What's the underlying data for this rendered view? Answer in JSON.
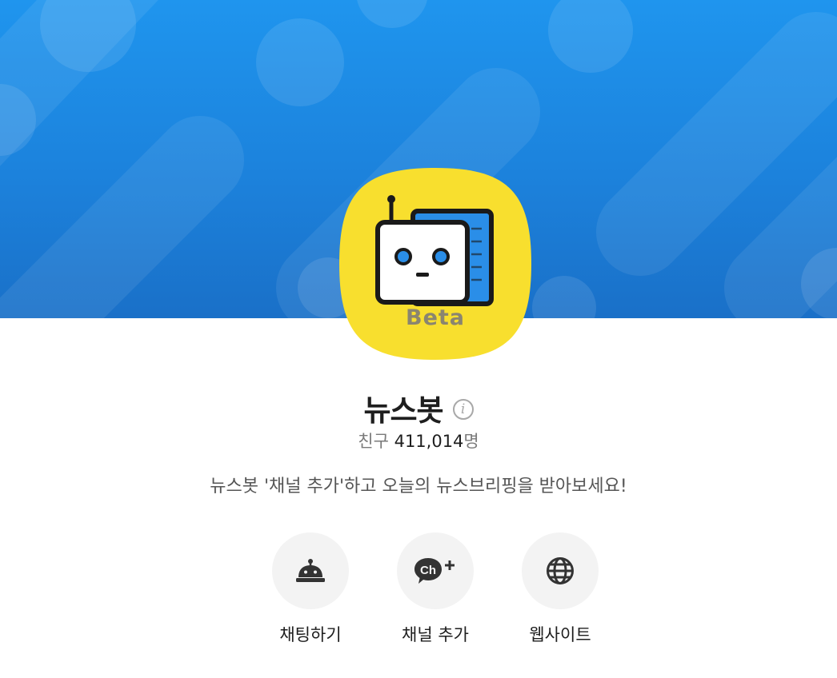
{
  "channel": {
    "name": "뉴스봇",
    "profile_badge": "Beta",
    "friends_label": "친구",
    "friends_count": "411,014",
    "friends_unit": "명",
    "description": "뉴스봇 '채널 추가'하고 오늘의 뉴스브리핑을 받아보세요!"
  },
  "info_icon": {
    "glyph": "i",
    "icon": "info-icon"
  },
  "actions": [
    {
      "label": "채팅하기",
      "icon": "chatbot-icon"
    },
    {
      "label": "채널 추가",
      "icon": "channel-add-icon",
      "icon_text": "Ch"
    },
    {
      "label": "웹사이트",
      "icon": "globe-icon"
    }
  ],
  "colors": {
    "cover_blue": "#1c82dc",
    "profile_yellow": "#f8df2e",
    "accent_blue": "#2a8ee8",
    "action_bg": "#f3f3f3"
  }
}
